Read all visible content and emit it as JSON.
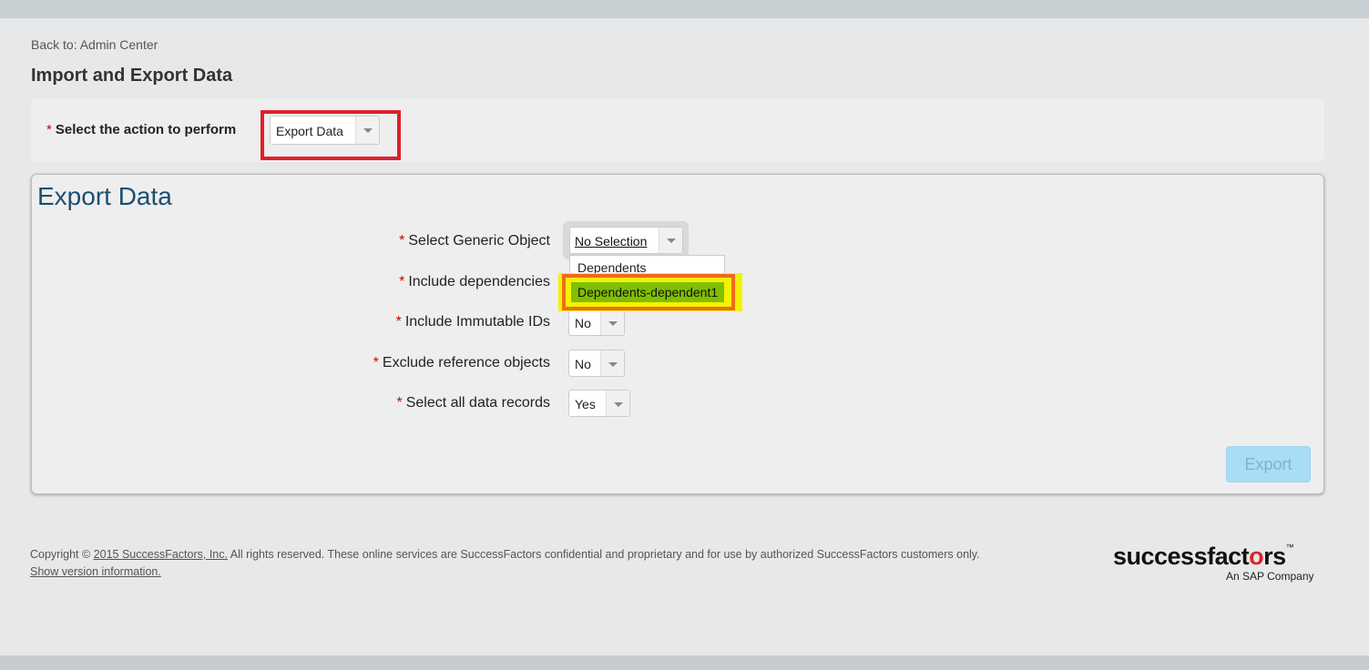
{
  "nav": {
    "back_link": "Back to: Admin Center"
  },
  "page": {
    "title": "Import and Export Data"
  },
  "action": {
    "required_marker": "*",
    "label": "Select the action to perform",
    "selected": "Export Data"
  },
  "export": {
    "title": "Export Data",
    "fields": [
      {
        "label": "Select Generic Object",
        "value": "No Selection"
      },
      {
        "label": "Include dependencies",
        "value": ""
      },
      {
        "label": "Include Immutable IDs",
        "value": "No"
      },
      {
        "label": "Exclude reference objects",
        "value": "No"
      },
      {
        "label": "Select all data records",
        "value": "Yes"
      }
    ],
    "dropdown_options": [
      "Dependents",
      "Dependents-dependent1"
    ],
    "button": "Export"
  },
  "footer": {
    "copyright_prefix": "Copyright ©",
    "company_link": "2015 SuccessFactors, Inc.",
    "copyright_suffix": "All rights reserved. These online services are SuccessFactors confidential and proprietary and for use by authorized SuccessFactors customers only.",
    "version_link": "Show version information."
  },
  "logo": {
    "main_pre": "successfact",
    "main_heart": "o",
    "main_post": "rs",
    "tm": "™",
    "sub": "An SAP Company"
  },
  "colors": {
    "highlight_red": "#e0202b",
    "highlight_orange": "#f06a1a",
    "highlight_yellow": "#f3f200",
    "selected_green": "#80bf00",
    "title_blue": "#1b4f72",
    "button_blue": "#a9ddf5"
  }
}
